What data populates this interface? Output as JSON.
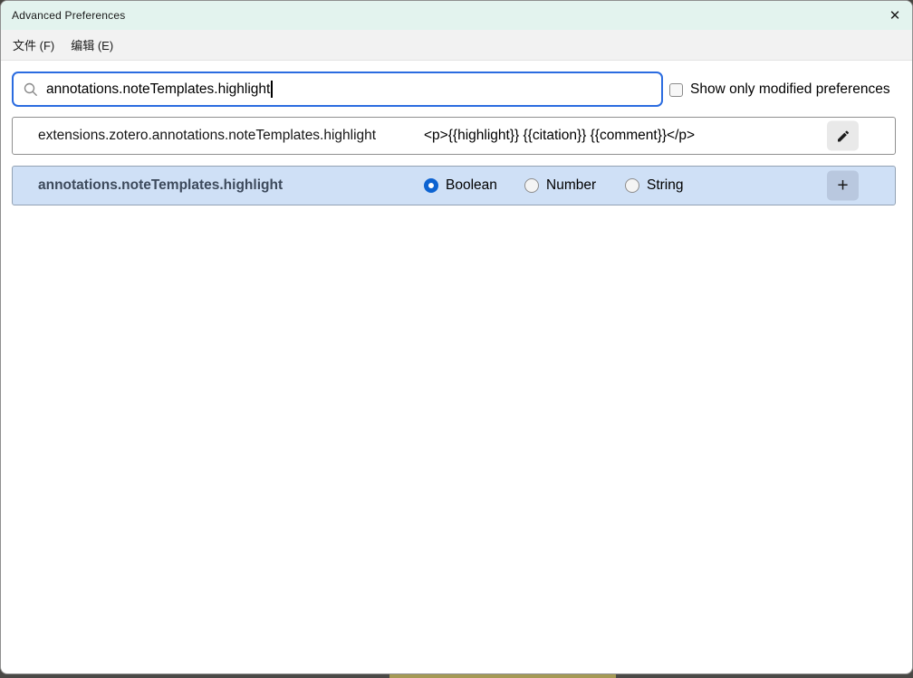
{
  "window": {
    "title": "Advanced Preferences",
    "close_icon": "✕"
  },
  "menubar": {
    "items": [
      {
        "label": "文件 (F)"
      },
      {
        "label": "编辑 (E)"
      }
    ]
  },
  "toolbar": {
    "search": {
      "value": "annotations.noteTemplates.highlight",
      "icon": "search-icon"
    },
    "show_only_modified": {
      "label": "Show only modified preferences",
      "checked": false
    }
  },
  "rows": {
    "existing": {
      "name": "extensions.zotero.annotations.noteTemplates.highlight",
      "value": "<p>{{highlight}} {{citation}} {{comment}}</p>",
      "edit_icon": "pencil-icon"
    },
    "new": {
      "name": "annotations.noteTemplates.highlight",
      "types": [
        "Boolean",
        "Number",
        "String"
      ],
      "selected_type": "Boolean",
      "add_button_label": "+"
    }
  },
  "colors": {
    "titlebar_bg": "#e3f3ee",
    "menubar_bg": "#f2f2f2",
    "focus_border_blue": "#2b6ce0",
    "selected_row_bg": "#cfe0f6",
    "radio_accent_blue": "#0d63d1"
  }
}
